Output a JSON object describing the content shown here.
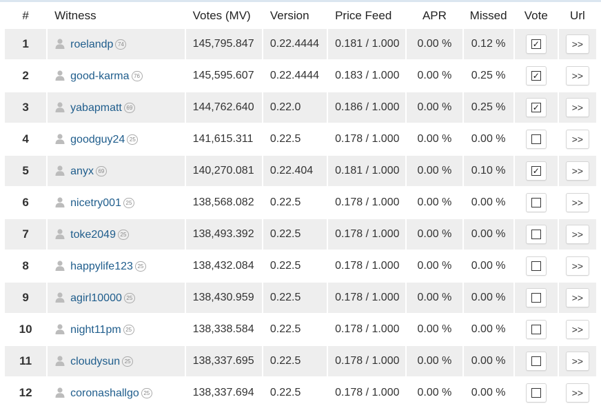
{
  "table": {
    "headers": {
      "rank": "#",
      "witness": "Witness",
      "votes": "Votes (MV)",
      "version": "Version",
      "price_feed": "Price Feed",
      "apr": "APR",
      "missed": "Missed",
      "vote": "Vote",
      "url": "Url"
    },
    "rows": [
      {
        "rank": "1",
        "name": "roelandp",
        "rep": "74",
        "votes": "145,795.847",
        "version": "0.22.4444",
        "price_feed": "0.181 / 1.000",
        "apr": "0.00 %",
        "missed": "0.12 %",
        "voted": true,
        "url_label": ">>"
      },
      {
        "rank": "2",
        "name": "good-karma",
        "rep": "76",
        "votes": "145,595.607",
        "version": "0.22.4444",
        "price_feed": "0.183 / 1.000",
        "apr": "0.00 %",
        "missed": "0.25 %",
        "voted": true,
        "url_label": ">>"
      },
      {
        "rank": "3",
        "name": "yabapmatt",
        "rep": "69",
        "votes": "144,762.640",
        "version": "0.22.0",
        "price_feed": "0.186 / 1.000",
        "apr": "0.00 %",
        "missed": "0.25 %",
        "voted": true,
        "url_label": ">>"
      },
      {
        "rank": "4",
        "name": "goodguy24",
        "rep": "25",
        "votes": "141,615.311",
        "version": "0.22.5",
        "price_feed": "0.178 / 1.000",
        "apr": "0.00 %",
        "missed": "0.00 %",
        "voted": false,
        "url_label": ">>"
      },
      {
        "rank": "5",
        "name": "anyx",
        "rep": "69",
        "votes": "140,270.081",
        "version": "0.22.404",
        "price_feed": "0.181 / 1.000",
        "apr": "0.00 %",
        "missed": "0.10 %",
        "voted": true,
        "url_label": ">>"
      },
      {
        "rank": "6",
        "name": "nicetry001",
        "rep": "25",
        "votes": "138,568.082",
        "version": "0.22.5",
        "price_feed": "0.178 / 1.000",
        "apr": "0.00 %",
        "missed": "0.00 %",
        "voted": false,
        "url_label": ">>"
      },
      {
        "rank": "7",
        "name": "toke2049",
        "rep": "25",
        "votes": "138,493.392",
        "version": "0.22.5",
        "price_feed": "0.178 / 1.000",
        "apr": "0.00 %",
        "missed": "0.00 %",
        "voted": false,
        "url_label": ">>"
      },
      {
        "rank": "8",
        "name": "happylife123",
        "rep": "25",
        "votes": "138,432.084",
        "version": "0.22.5",
        "price_feed": "0.178 / 1.000",
        "apr": "0.00 %",
        "missed": "0.00 %",
        "voted": false,
        "url_label": ">>"
      },
      {
        "rank": "9",
        "name": "agirl10000",
        "rep": "25",
        "votes": "138,430.959",
        "version": "0.22.5",
        "price_feed": "0.178 / 1.000",
        "apr": "0.00 %",
        "missed": "0.00 %",
        "voted": false,
        "url_label": ">>"
      },
      {
        "rank": "10",
        "name": "night11pm",
        "rep": "25",
        "votes": "138,338.584",
        "version": "0.22.5",
        "price_feed": "0.178 / 1.000",
        "apr": "0.00 %",
        "missed": "0.00 %",
        "voted": false,
        "url_label": ">>"
      },
      {
        "rank": "11",
        "name": "cloudysun",
        "rep": "25",
        "votes": "138,337.695",
        "version": "0.22.5",
        "price_feed": "0.178 / 1.000",
        "apr": "0.00 %",
        "missed": "0.00 %",
        "voted": false,
        "url_label": ">>"
      },
      {
        "rank": "12",
        "name": "coronashallgo",
        "rep": "25",
        "votes": "138,337.694",
        "version": "0.22.5",
        "price_feed": "0.178 / 1.000",
        "apr": "0.00 %",
        "missed": "0.00 %",
        "voted": false,
        "url_label": ">>"
      }
    ]
  },
  "colors": {
    "link": "#1f5d8c",
    "row_alt": "#eeeeee",
    "row": "#ffffff"
  },
  "icons": {
    "user": "user-icon",
    "checkbox_checked": "checkbox-checked-icon",
    "checkbox_unchecked": "checkbox-unchecked-icon"
  },
  "checkmark": "✓"
}
